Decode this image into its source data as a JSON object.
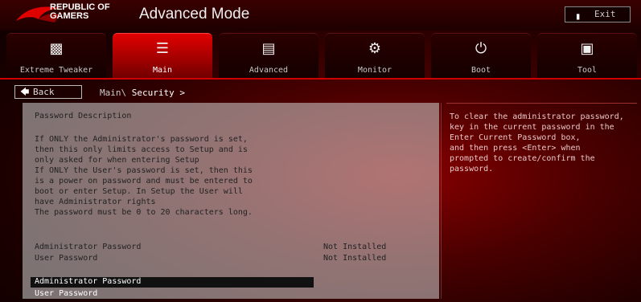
{
  "header": {
    "logo_line1": "REPUBLIC OF",
    "logo_line2": "GAMERS",
    "title": "Advanced Mode",
    "exit_label": "Exit"
  },
  "tabs": [
    {
      "label": "Extreme Tweaker",
      "icon": "gauge-icon"
    },
    {
      "label": "Main",
      "icon": "list-icon"
    },
    {
      "label": "Advanced",
      "icon": "advanced-icon"
    },
    {
      "label": "Monitor",
      "icon": "monitor-icon"
    },
    {
      "label": "Boot",
      "icon": "power-icon"
    },
    {
      "label": "Tool",
      "icon": "tool-icon"
    }
  ],
  "nav": {
    "back_label": "Back",
    "crumb_root": "Main\\",
    "crumb_current": "Security >"
  },
  "main": {
    "section_title": "Password Description",
    "description": [
      "If ONLY the Administrator's password is set,",
      "then this only limits access to Setup and is",
      "only asked for when entering Setup",
      "If ONLY the User's password is set, then this",
      "is a power on password and must be entered to",
      "boot or enter Setup. In Setup the User will",
      "have Administrator rights",
      "The password must be 0 to 20 characters long."
    ],
    "status_rows": [
      {
        "label": "Administrator Password",
        "value": "Not Installed"
      },
      {
        "label": "User Password",
        "value": "Not Installed"
      }
    ],
    "options": [
      {
        "label": "Administrator Password",
        "selected": true
      },
      {
        "label": "User Password",
        "selected": false
      }
    ]
  },
  "help": {
    "lines": [
      "To clear the administrator password,",
      "key in the current password in the",
      "Enter Current Password box,",
      "and then press <Enter> when",
      "prompted to create/confirm the",
      "password."
    ]
  }
}
